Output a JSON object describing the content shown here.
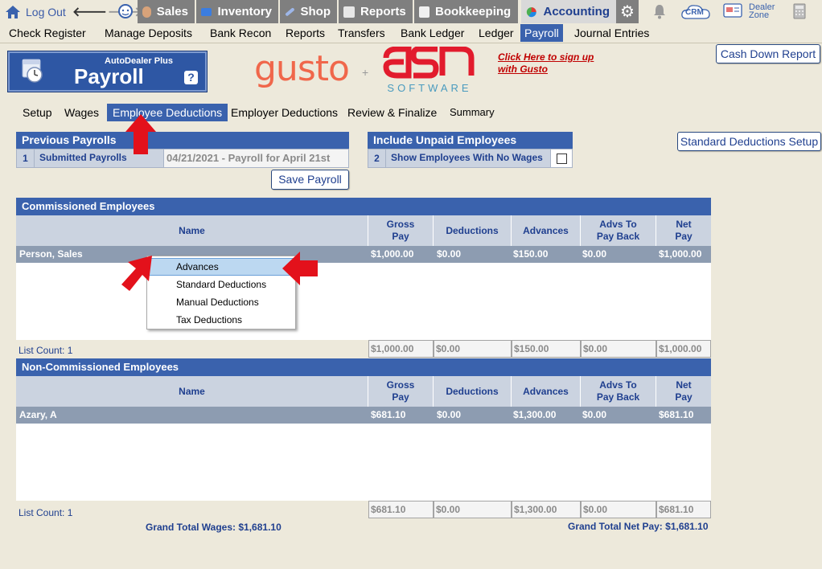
{
  "topnav": {
    "logout": "Log Out",
    "modules": [
      {
        "label": "Sales",
        "icon": "sales-icon"
      },
      {
        "label": "Inventory",
        "icon": "car-icon"
      },
      {
        "label": "Shop",
        "icon": "wrench-icon"
      },
      {
        "label": "Reports",
        "icon": "reports-icon"
      },
      {
        "label": "Bookkeeping",
        "icon": "book-icon"
      },
      {
        "label": "Accounting",
        "icon": "pie-chart-icon"
      }
    ],
    "crm": "CRM",
    "dealer_zone": [
      "Dealer",
      "Zone"
    ]
  },
  "subnav": {
    "items": [
      "Check Register",
      "Manage Deposits",
      "Bank Recon",
      "Reports",
      "Transfers",
      "Bank Ledger",
      "Ledger",
      "Payroll",
      "Journal Entries"
    ],
    "active": "Payroll"
  },
  "header": {
    "logo_subtitle": "AutoDealer Plus",
    "logo_title": "Payroll",
    "help": "?",
    "gusto": "gusto",
    "plus": "+",
    "asn_software": "SOFTWARE",
    "signup_line1": "Click Here to sign up",
    "signup_line2": "with Gusto",
    "cash_down_report": "Cash Down Report"
  },
  "tabs": {
    "items": [
      "Setup",
      "Wages",
      "Employee Deductions",
      "Employer Deductions",
      "Review & Finalize",
      "Summary"
    ],
    "active": "Employee Deductions"
  },
  "previous_payrolls": {
    "title": "Previous Payrolls",
    "row_num": "1",
    "row_label": "Submitted Payrolls",
    "selected": "04/21/2021 - Payroll for April 21st"
  },
  "unpaid": {
    "title": "Include Unpaid Employees",
    "row_num": "2",
    "row_label": "Show Employees With No Wages",
    "checked": false
  },
  "buttons": {
    "save_payroll": "Save Payroll",
    "standard_deductions_setup": "Standard Deductions Setup"
  },
  "columns": {
    "name": "Name",
    "gross_1": "Gross",
    "gross_2": "Pay",
    "deductions": "Deductions",
    "advances": "Advances",
    "advs_1": "Advs To",
    "advs_2": "Pay Back",
    "net_1": "Net",
    "net_2": "Pay"
  },
  "commissioned": {
    "title": "Commissioned Employees",
    "rows": [
      {
        "name": "Person, Sales",
        "gross": "$1,000.00",
        "deductions": "$0.00",
        "advances": "$150.00",
        "advs_back": "$0.00",
        "net": "$1,000.00"
      }
    ],
    "list_count": "List Count: 1",
    "totals": {
      "gross": "$1,000.00",
      "deductions": "$0.00",
      "advances": "$150.00",
      "advs_back": "$0.00",
      "net": "$1,000.00"
    }
  },
  "noncommissioned": {
    "title": "Non-Commissioned Employees",
    "rows": [
      {
        "name": "Azary, A",
        "gross": "$681.10",
        "deductions": "$0.00",
        "advances": "$1,300.00",
        "advs_back": "$0.00",
        "net": "$681.10"
      }
    ],
    "list_count": "List Count: 1",
    "totals": {
      "gross": "$681.10",
      "deductions": "$0.00",
      "advances": "$1,300.00",
      "advs_back": "$0.00",
      "net": "$681.10"
    }
  },
  "grand": {
    "wages_label": "Grand Total Wages:",
    "wages_value": "$1,681.10",
    "net_label": "Grand Total Net Pay:",
    "net_value": "$1,681.10"
  },
  "context_menu": {
    "items": [
      "Advances",
      "Standard Deductions",
      "Manual Deductions",
      "Tax Deductions"
    ],
    "highlighted": "Advances"
  },
  "colors": {
    "accent": "#3a62ad",
    "nav_gray": "#7f7f7f",
    "row_gray_blue": "#8d9cb1",
    "header_light": "#cbd3e0",
    "background": "#ede9db",
    "arrow_red": "#e3111b"
  }
}
